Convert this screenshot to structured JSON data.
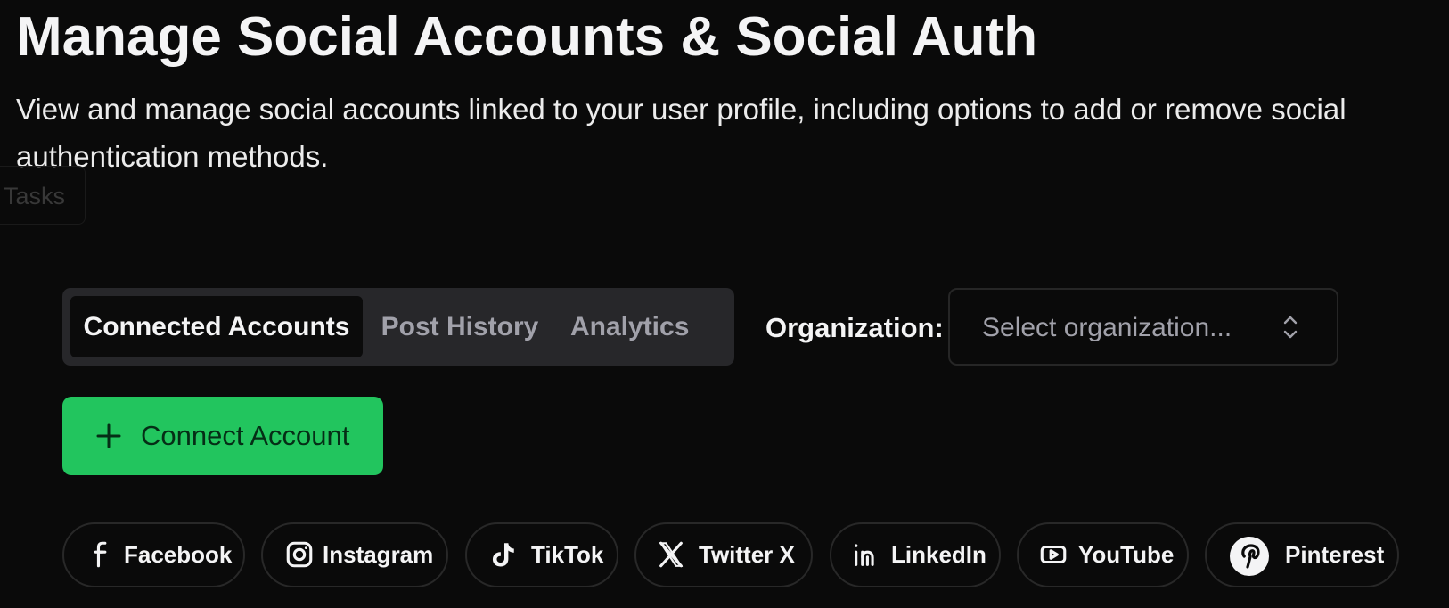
{
  "header": {
    "title": "Manage Social Accounts & Social Auth",
    "description": "View and manage social accounts linked to your user profile, including options to add or remove social authentication methods."
  },
  "background_ui": {
    "tasks_label": "Tasks"
  },
  "tabs": [
    {
      "label": "Connected Accounts",
      "active": true
    },
    {
      "label": "Post History",
      "active": false
    },
    {
      "label": "Analytics",
      "active": false
    }
  ],
  "organization": {
    "label": "Organization:",
    "placeholder": "Select organization...",
    "icon": "chevron-up-down-icon"
  },
  "connect_account": {
    "label": "Connect Account",
    "icon": "plus-icon",
    "color": "#22c55e"
  },
  "social_accounts": [
    {
      "label": "Facebook",
      "icon": "facebook-icon"
    },
    {
      "label": "Instagram",
      "icon": "instagram-icon"
    },
    {
      "label": "TikTok",
      "icon": "tiktok-icon"
    },
    {
      "label": "Twitter X",
      "icon": "x-icon"
    },
    {
      "label": "LinkedIn",
      "icon": "linkedin-icon"
    },
    {
      "label": "YouTube",
      "icon": "youtube-icon"
    },
    {
      "label": "Pinterest",
      "icon": "pinterest-icon"
    }
  ],
  "theme": {
    "background": "#0a0a0a",
    "panel": "#27272a",
    "accent": "#22c55e",
    "text": "#f4f4f5",
    "muted_text": "#a1a1aa"
  }
}
